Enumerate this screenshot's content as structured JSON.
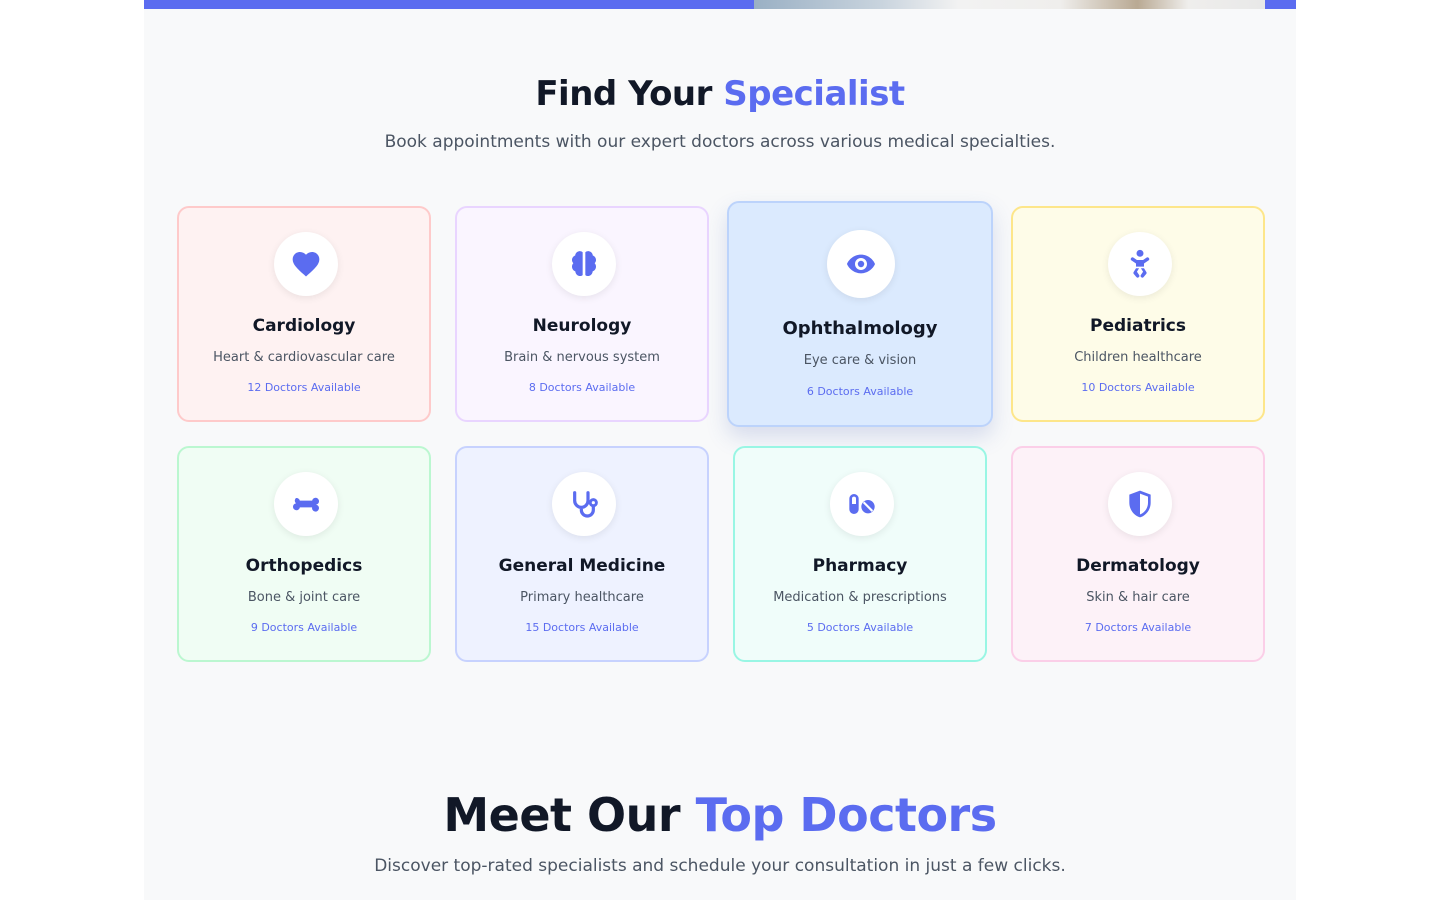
{
  "specialists": {
    "title_main": "Find Your",
    "title_accent": "Specialist",
    "subtitle": "Book appointments with our expert doctors across various medical specialties.",
    "cards": [
      {
        "name": "Cardiology",
        "desc": "Heart & cardiovascular care",
        "count": "12 Doctors Available",
        "icon": "heart-icon",
        "bg": "#fef2f2",
        "border": "#fecaca"
      },
      {
        "name": "Neurology",
        "desc": "Brain & nervous system",
        "count": "8 Doctors Available",
        "icon": "brain-icon",
        "bg": "#faf5ff",
        "border": "#e9d5ff"
      },
      {
        "name": "Ophthalmology",
        "desc": "Eye care & vision",
        "count": "6 Doctors Available",
        "icon": "eye-icon",
        "bg": "#dbeafe",
        "border": "#bfdbfe"
      },
      {
        "name": "Pediatrics",
        "desc": "Children healthcare",
        "count": "10 Doctors Available",
        "icon": "baby-icon",
        "bg": "#fefce8",
        "border": "#fef08a"
      },
      {
        "name": "Orthopedics",
        "desc": "Bone & joint care",
        "count": "9 Doctors Available",
        "icon": "bone-icon",
        "bg": "#f0fdf4",
        "border": "#bbf7d0"
      },
      {
        "name": "General Medicine",
        "desc": "Primary healthcare",
        "count": "15 Doctors Available",
        "icon": "stethoscope-icon",
        "bg": "#eef2ff",
        "border": "#c7d2fe"
      },
      {
        "name": "Pharmacy",
        "desc": "Medication & prescriptions",
        "count": "5 Doctors Available",
        "icon": "pills-icon",
        "bg": "#f0fdfa",
        "border": "#99f6e4"
      },
      {
        "name": "Dermatology",
        "desc": "Skin & hair care",
        "count": "7 Doctors Available",
        "icon": "shield-icon",
        "bg": "#fdf2f8",
        "border": "#fbcfe8"
      }
    ]
  },
  "doctors": {
    "title_main": "Meet Our",
    "title_accent": "Top Doctors",
    "subtitle": "Discover top-rated specialists and schedule your consultation in just a few clicks."
  },
  "colors": {
    "accent": "#5b6cf0",
    "heading": "#111827",
    "body_text": "#4b5563",
    "section_bg": "#f8f9fa"
  }
}
